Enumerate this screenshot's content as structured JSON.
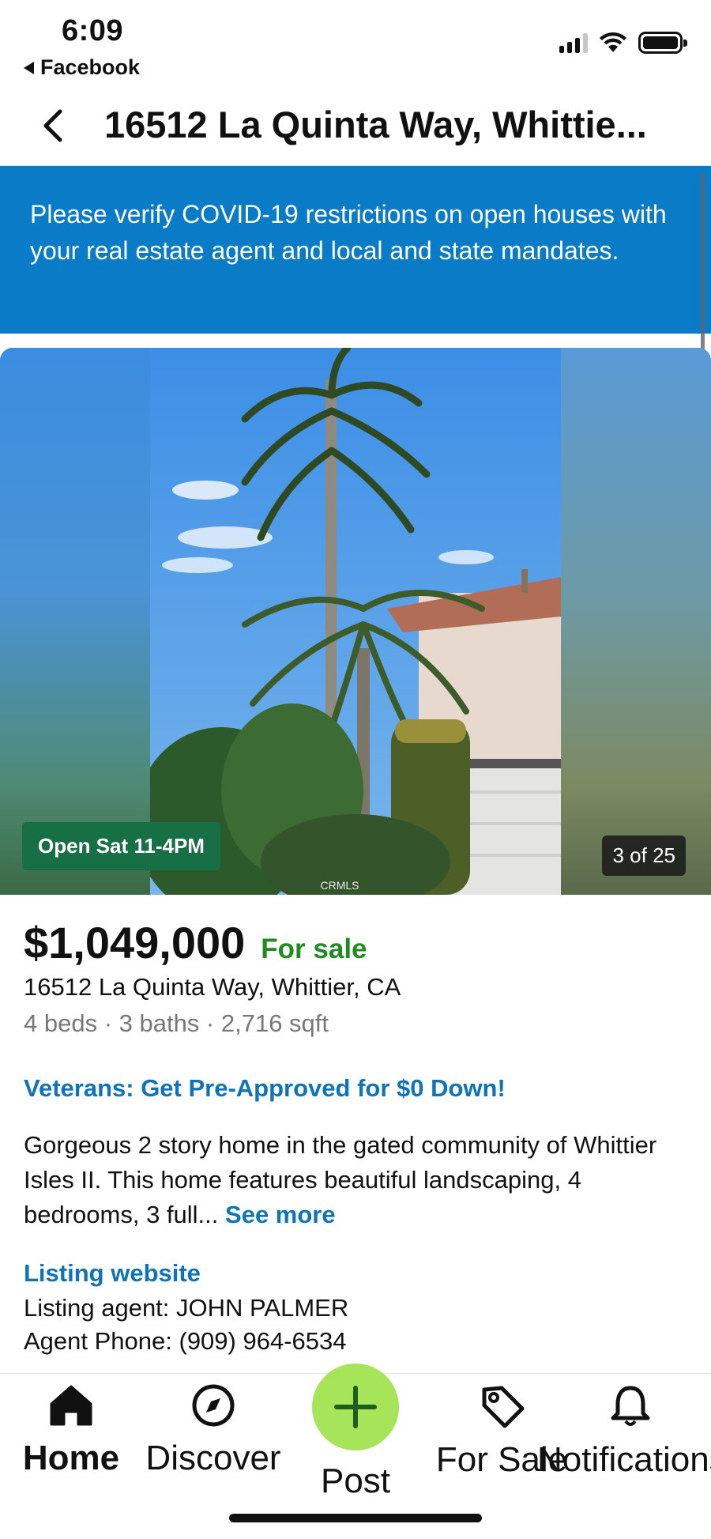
{
  "status_bar": {
    "time": "6:09",
    "back_app": "Facebook"
  },
  "header": {
    "title": "16512 La Quinta Way, Whittie..."
  },
  "banner": {
    "text": "Please verify COVID-19 restrictions on open houses with your real estate agent and local and state mandates."
  },
  "photo": {
    "open_house": "Open Sat 11-4PM",
    "counter": "3 of 25",
    "watermark": "CRMLS"
  },
  "listing": {
    "price": "$1,049,000",
    "status": "For sale",
    "address": "16512 La Quinta Way, Whittier, CA",
    "facts": "4 beds · 3 baths · 2,716 sqft",
    "veterans_link": "Veterans: Get Pre-Approved for $0 Down!",
    "description": "Gorgeous 2 story home in the gated community of Whittier Isles II. This home features beautiful landscaping, 4 bedrooms, 3 full...",
    "see_more": "See more",
    "listing_website": "Listing website",
    "listing_agent": "Listing agent: JOHN PALMER",
    "agent_phone": "Agent Phone: (909) 964-6534"
  },
  "bottom_nav": {
    "items": [
      {
        "label": "Home",
        "icon": "home-icon"
      },
      {
        "label": "Discover",
        "icon": "compass-icon"
      },
      {
        "label": "Post",
        "icon": "plus-icon"
      },
      {
        "label": "For Sale",
        "icon": "price-tag-icon"
      },
      {
        "label": "Notifications",
        "icon": "bell-icon"
      }
    ]
  },
  "colors": {
    "banner_bg": "#0a7cc7",
    "link": "#0e73b9",
    "for_sale": "#218b21",
    "open_badge": "#176f45",
    "post_button": "#a6e45a"
  }
}
